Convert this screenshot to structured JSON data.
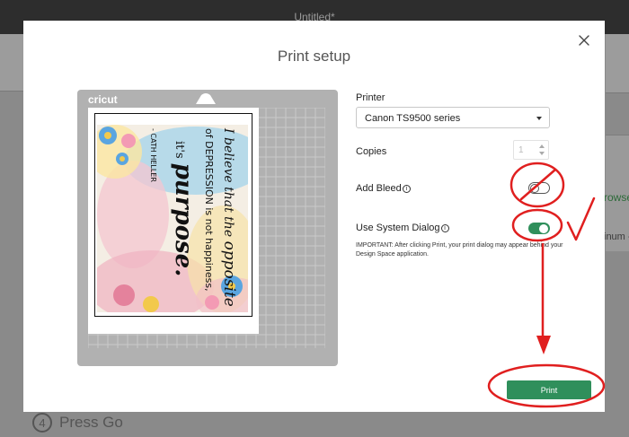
{
  "app": {
    "window_title": "Untitled*"
  },
  "background": {
    "step_number": "4",
    "step_label": "Press Go",
    "right_link_fragment": "rowse",
    "right_text_fragment": "inum -"
  },
  "dialog": {
    "title": "Print setup",
    "mat_brand": "cricut",
    "printer": {
      "label": "Printer",
      "value": "Canon TS9500 series"
    },
    "copies": {
      "label": "Copies",
      "value": "1"
    },
    "add_bleed": {
      "label": "Add Bleed",
      "info": "i",
      "enabled": false
    },
    "system_dialog": {
      "label": "Use System Dialog",
      "info": "i",
      "enabled": true
    },
    "note": "IMPORTANT: After clicking Print, your print dialog may appear behind your Design Space application.",
    "print_button": "Print"
  },
  "artwork": {
    "line1": "I believe that the",
    "line1b": "opposite",
    "line2": "of DEPRESSION is not happiness,",
    "line3": "it's",
    "line3b": "purpose.",
    "attribution": "- CATH HELLER"
  },
  "colors": {
    "accent_green": "#2f8f5b",
    "annotation_red": "#e01f1f",
    "topbar": "#2d2d2d",
    "mat_gray": "#b1b1b1"
  },
  "icons": [
    "close-icon",
    "caret-down-icon",
    "stepper-up-icon",
    "stepper-down-icon",
    "info-icon"
  ]
}
